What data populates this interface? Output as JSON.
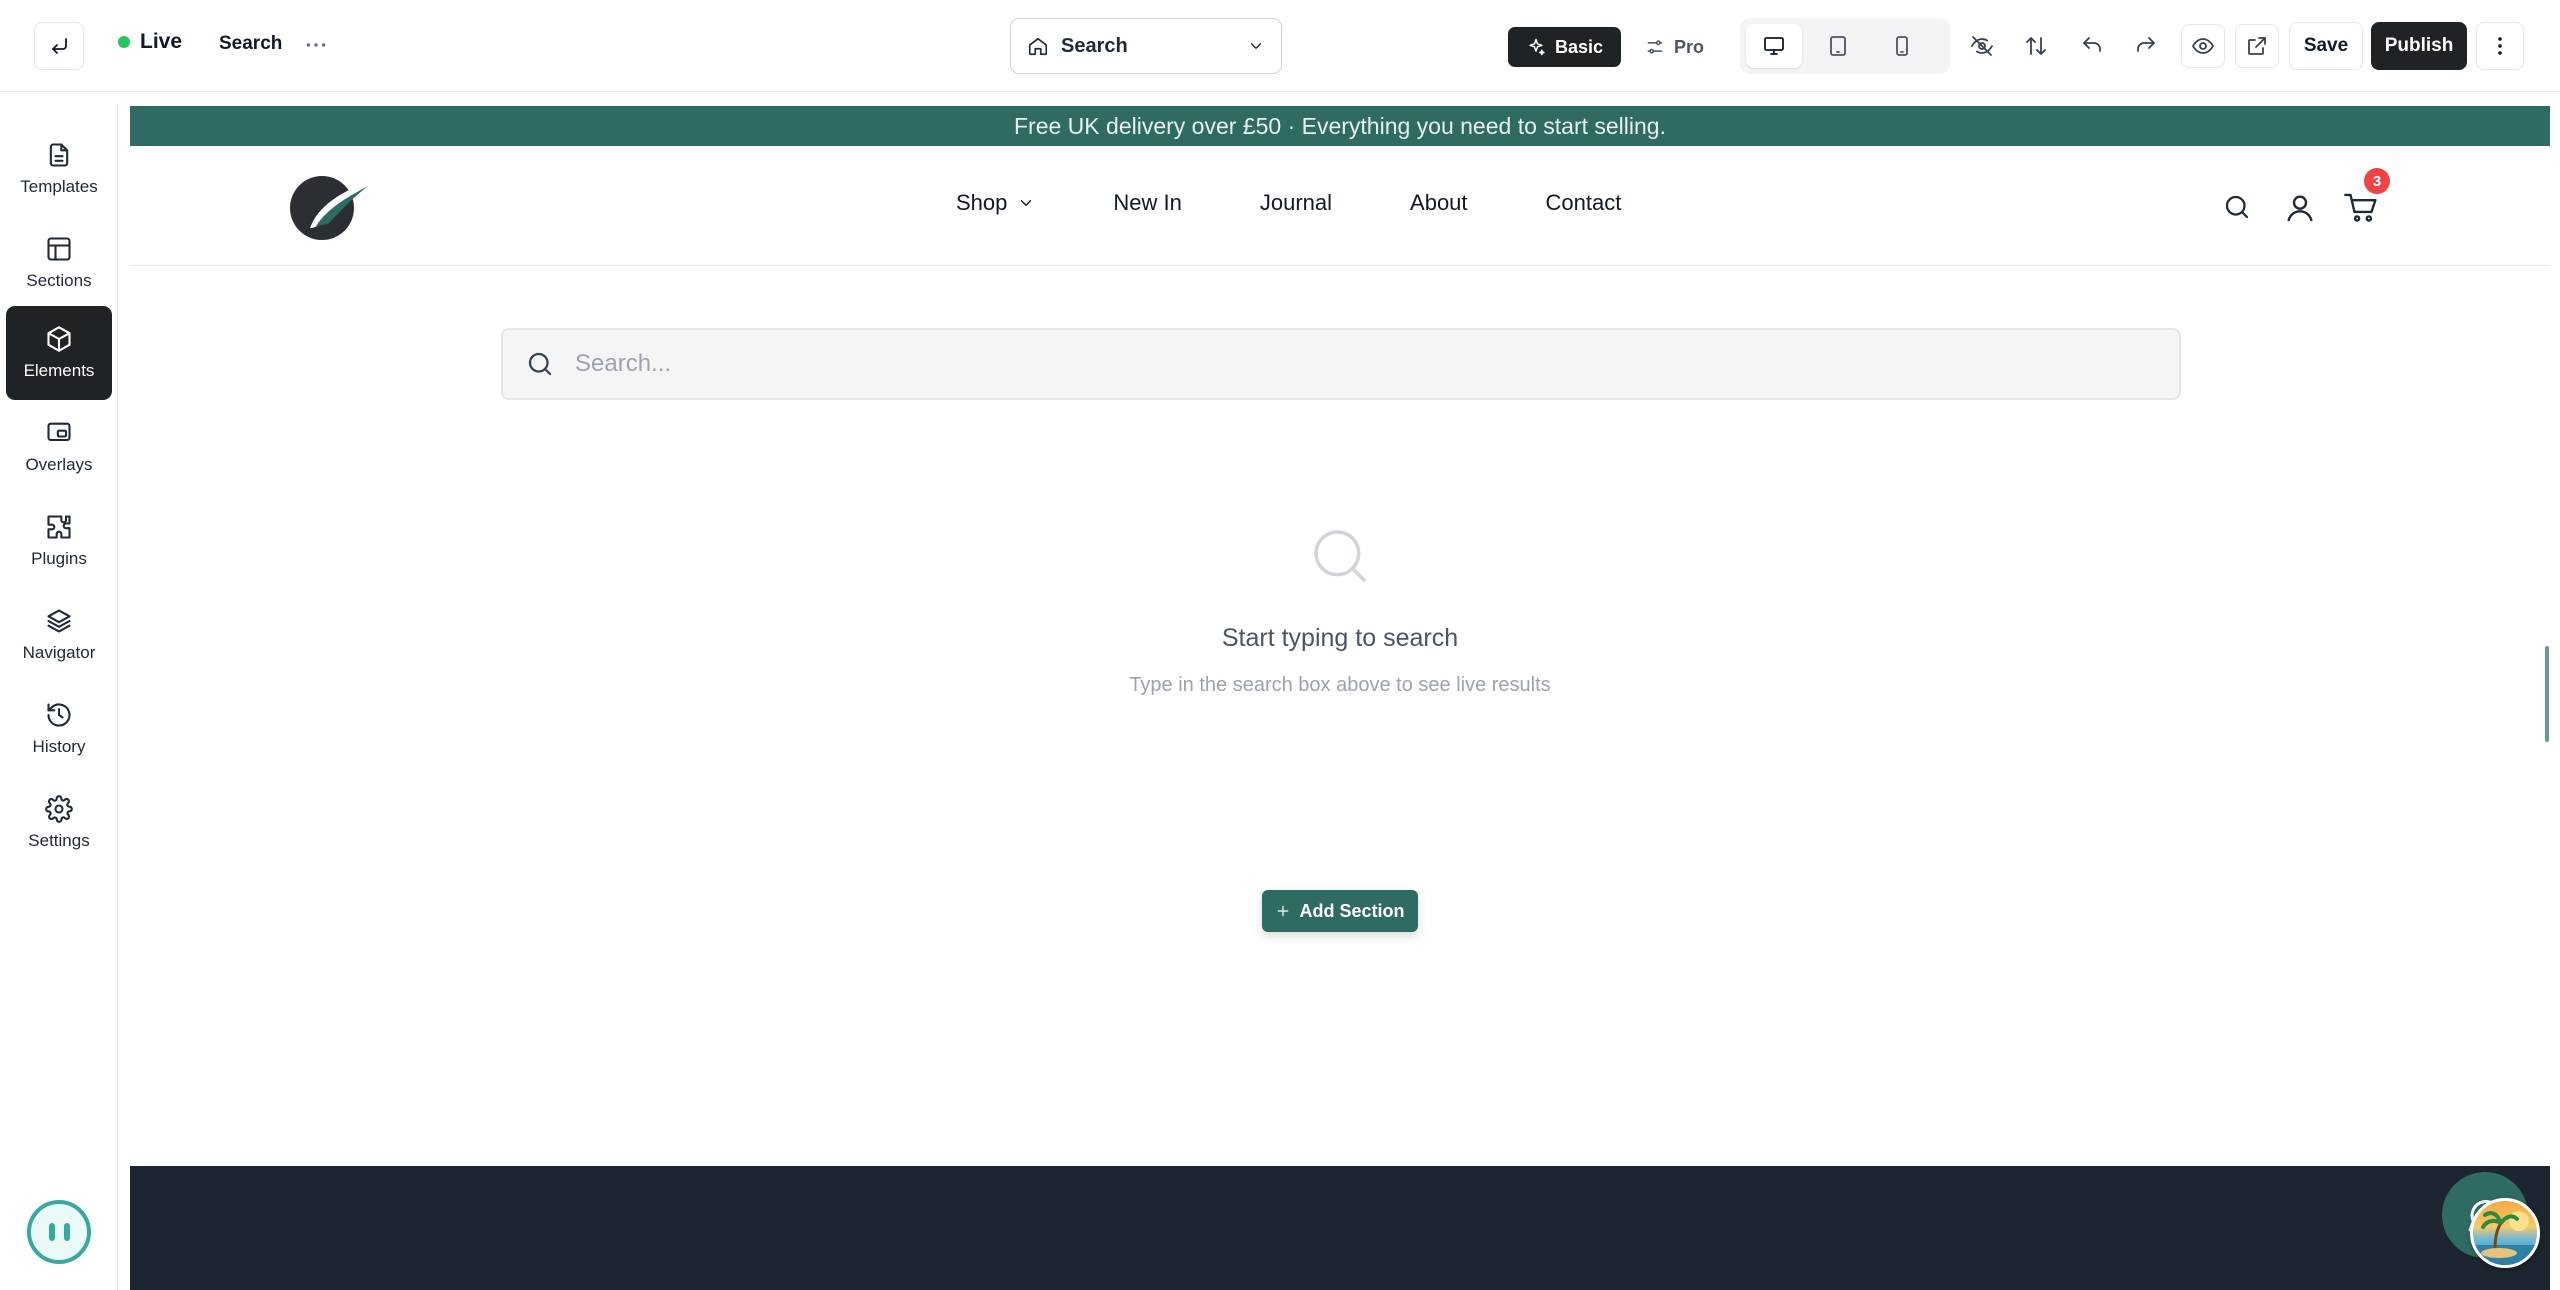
{
  "topbar": {
    "status_label": "Live",
    "page_name": "Search",
    "page_select_value": "Search",
    "mode_basic": "Basic",
    "mode_pro": "Pro",
    "save_label": "Save",
    "publish_label": "Publish"
  },
  "sidebar": {
    "items": [
      {
        "label": "Templates",
        "icon": "file-icon"
      },
      {
        "label": "Sections",
        "icon": "layout-icon"
      },
      {
        "label": "Elements",
        "icon": "cube-icon"
      },
      {
        "label": "Overlays",
        "icon": "overlay-icon"
      },
      {
        "label": "Plugins",
        "icon": "puzzle-icon"
      },
      {
        "label": "Navigator",
        "icon": "layers-icon"
      },
      {
        "label": "History",
        "icon": "history-icon"
      },
      {
        "label": "Settings",
        "icon": "gear-icon"
      }
    ],
    "active": "Elements"
  },
  "site": {
    "announcement": "Free UK delivery over £50 · Everything you need to start selling.",
    "nav": [
      "Shop",
      "New In",
      "Journal",
      "About",
      "Contact"
    ],
    "cart_count": "3",
    "search_placeholder": "Search...",
    "empty_title": "Start typing to search",
    "empty_subtitle": "Type in the search box above to see live results",
    "add_section_label": "Add Section"
  },
  "colors": {
    "brand": "#2f6b63",
    "dark": "#1f2326",
    "footer": "#1c2530",
    "live": "#22c55e",
    "badge": "#ef4444"
  }
}
